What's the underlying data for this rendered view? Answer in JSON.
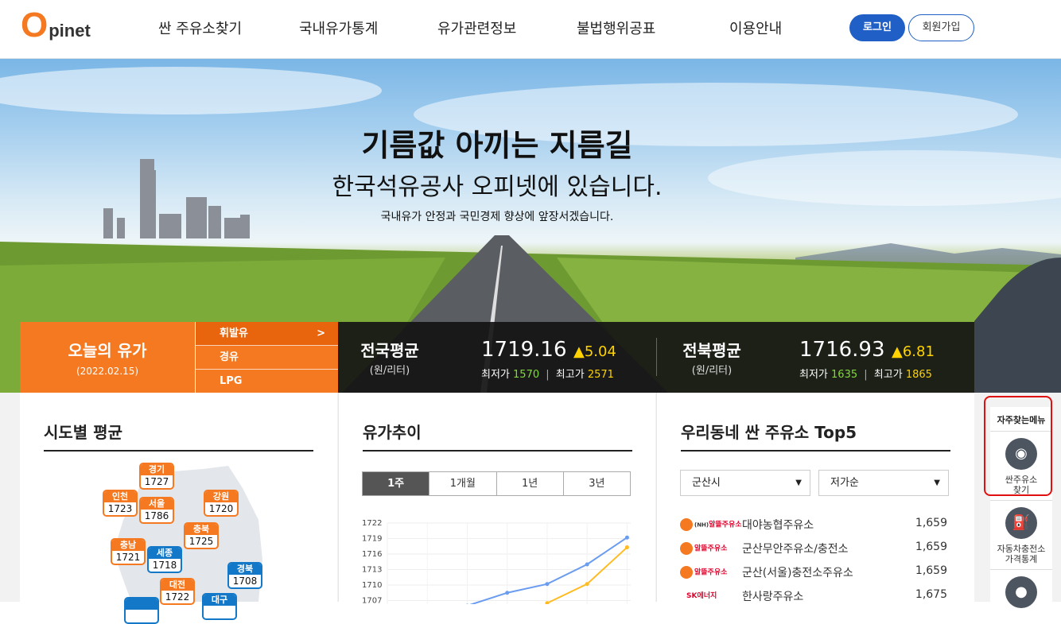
{
  "header": {
    "logo_o": "O",
    "logo_rest": "pinet",
    "nav": [
      "싼 주유소찾기",
      "국내유가통계",
      "유가관련정보",
      "불법행위공표",
      "이용안내"
    ],
    "login": "로그인",
    "join": "회원가입"
  },
  "hero": {
    "title": "기름값 아끼는 지름길",
    "subtitle": "한국석유공사 오피넷에 있습니다.",
    "small": "국내유가 안정과 국민경제 향상에 앞장서겠습니다."
  },
  "today": {
    "title": "오늘의 유가",
    "date": "(2022.02.15)",
    "fuels": [
      {
        "label": "휘발유",
        "arrow": ">"
      },
      {
        "label": "경유"
      },
      {
        "label": "LPG"
      }
    ]
  },
  "prices": {
    "national": {
      "name": "전국평균",
      "unit": "(원/리터)",
      "avg": "1719.16",
      "change": "▲5.04",
      "min_label": "최저가",
      "min": "1570",
      "max_label": "최고가",
      "max": "2571"
    },
    "region": {
      "name": "전북평균",
      "unit": "(원/리터)",
      "avg": "1716.93",
      "change": "▲6.81",
      "min_label": "최저가",
      "min": "1635",
      "max_label": "최고가",
      "max": "1865"
    },
    "sep": "|"
  },
  "sido": {
    "title": "시도별 평균",
    "regions": [
      {
        "name": "경기",
        "value": "1727",
        "color": "orange"
      },
      {
        "name": "인천",
        "value": "1723",
        "color": "orange"
      },
      {
        "name": "서울",
        "value": "1786",
        "color": "orange"
      },
      {
        "name": "강원",
        "value": "1720",
        "color": "orange"
      },
      {
        "name": "충북",
        "value": "1725",
        "color": "orange"
      },
      {
        "name": "충남",
        "value": "1721",
        "color": "orange"
      },
      {
        "name": "세종",
        "value": "1718",
        "color": "blue"
      },
      {
        "name": "경북",
        "value": "1708",
        "color": "blue"
      },
      {
        "name": "대전",
        "value": "1722",
        "color": "orange"
      },
      {
        "name": "대구",
        "value": "",
        "color": "blue"
      }
    ]
  },
  "trend": {
    "title": "유가추이",
    "periods": [
      "1주",
      "1개월",
      "1년",
      "3년"
    ],
    "active_period": "1주"
  },
  "chart_data": {
    "type": "line",
    "title": "",
    "ylim": [
      1705,
      1722
    ],
    "ytick_labels": [
      "1722",
      "1719",
      "1716",
      "1713",
      "1710",
      "1707"
    ],
    "x": [
      1,
      2,
      3,
      4,
      5,
      6,
      7
    ],
    "series": [
      {
        "color": "#6a9cf0",
        "values": [
          null,
          null,
          1706,
          1708.5,
          1710.2,
          1714.0,
          1719.2
        ]
      },
      {
        "color": "#ffbb22",
        "values": [
          null,
          null,
          null,
          null,
          1706.5,
          1710.2,
          1717.3
        ]
      }
    ]
  },
  "top5": {
    "title": "우리동네 싼 주유소 Top5",
    "city": "군산시",
    "order": "저가순",
    "stations": [
      {
        "brand": "알뜰주유소",
        "brand_prefix": "(NH)",
        "name": "대야농협주유소",
        "price": "1,659",
        "brand_color": "#e4002b"
      },
      {
        "brand": "알뜰주유소",
        "brand_prefix": "",
        "name": "군산무안주유소/충전소",
        "price": "1,659",
        "brand_color": "#e4002b"
      },
      {
        "brand": "알뜰주유소",
        "brand_prefix": "",
        "name": "군산(서울)충전소주유소",
        "price": "1,659",
        "brand_color": "#e4002b"
      },
      {
        "brand": "SK에너지",
        "brand_prefix": "",
        "name": "한사랑주유소",
        "price": "1,675",
        "brand_color": "#e4002b"
      }
    ]
  },
  "quick": {
    "title": "자주찾는메뉴",
    "items": [
      {
        "label1": "싼주유소",
        "label2": "찾기",
        "icon": "location-pin-icon"
      },
      {
        "label1": "자동차충전소",
        "label2": "가격통계",
        "icon": "gas-pump-icon"
      },
      {
        "label1": "",
        "label2": "",
        "icon": "korea-map-icon"
      }
    ]
  },
  "colors": {
    "brand": "#f47920",
    "accent_blue": "#1f5fc6",
    "annotation_red": "#e01010"
  }
}
